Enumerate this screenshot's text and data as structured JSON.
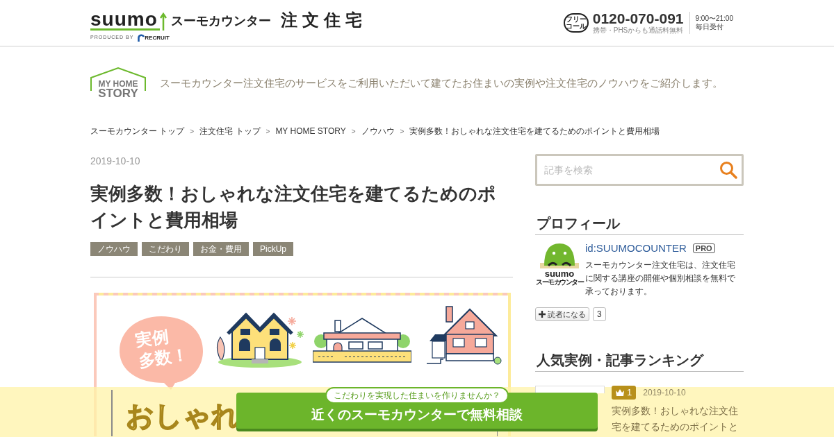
{
  "header": {
    "logo": {
      "brand": "suumo",
      "service": "スーモカウンター",
      "category": "注文住宅",
      "produced_by": "PRODUCED BY",
      "company": "RECRUIT"
    },
    "contact": {
      "free_call_mark": [
        "フリー",
        "コール"
      ],
      "phone": "0120-070-091",
      "note": "携帯・PHSからも通話料無料",
      "hours": "9:00〜21:00",
      "days": "毎日受付"
    }
  },
  "intro": {
    "logo": [
      "MY HOME",
      "STORY"
    ],
    "tagline": "スーモカウンター注文住宅のサービスをご利用いただいて建てたお住まいの実例や注文住宅のノウハウをご紹介します。"
  },
  "breadcrumb": [
    {
      "label": "スーモカウンター トップ"
    },
    {
      "separator": ">",
      "label": "注文住宅 トップ"
    },
    {
      "separator": ">",
      "label": "MY HOME STORY"
    },
    {
      "separator": ">",
      "label": "ノウハウ"
    },
    {
      "separator": ">",
      "label": "実例多数！おしゃれな注文住宅を建てるためのポイントと費用相場"
    }
  ],
  "article": {
    "date": "2019-10-10",
    "title": "実例多数！おしゃれな注文住宅を建てるためのポイントと費用相場",
    "tags": [
      "ノウハウ",
      "こだわり",
      "お金・費用",
      "PickUp"
    ],
    "hero": {
      "bubble_lines": [
        "実例",
        "多数！"
      ],
      "headline": "おしゃれ"
    }
  },
  "sidebar": {
    "search": {
      "placeholder": "記事を検索"
    },
    "profile": {
      "heading": "プロフィール",
      "avatar_logo": {
        "brand": "suumo",
        "service": "スーモカウンター"
      },
      "name": "id:SUUMOCOUNTER",
      "badge": "PRO",
      "description": "スーモカウンター注文住宅は、注文住宅に関する講座の開催や個別相談を無料で承っております。",
      "follow": {
        "label": "読者になる",
        "count": "3"
      }
    },
    "ranking": {
      "heading": "人気実例・記事ランキング",
      "items": [
        {
          "rank": "1",
          "date": "2019-10-10",
          "title": "実例多数！おしゃれな注文住宅を建てるためのポイントと"
        }
      ]
    }
  },
  "cta": {
    "prompt": "こだわりを実現した住まいを作りませんか？",
    "label": "近くのスーモカウンターで無料相談"
  }
}
